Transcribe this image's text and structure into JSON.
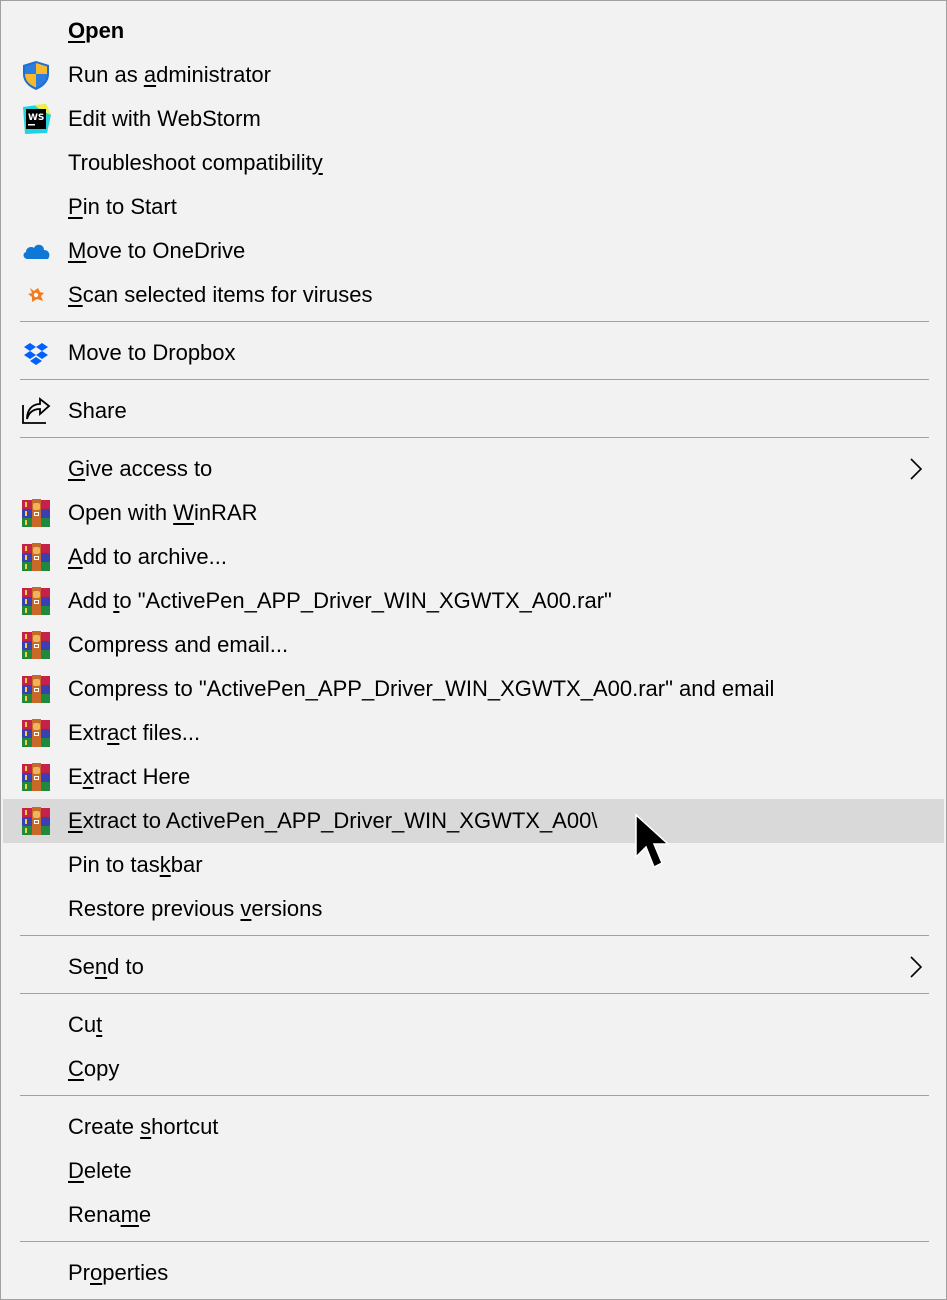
{
  "menu": {
    "highlight_color": "#d9d9d9",
    "items": [
      {
        "id": "open",
        "label": "Open",
        "accel_index": 0,
        "bold": true,
        "icon": null
      },
      {
        "id": "run-as-admin",
        "label": "Run as administrator",
        "accel_index": 7,
        "icon": "uac-shield-icon"
      },
      {
        "id": "edit-webstorm",
        "label": "Edit with WebStorm",
        "accel_index": -1,
        "icon": "webstorm-icon"
      },
      {
        "id": "troubleshoot",
        "label": "Troubleshoot compatibility",
        "accel_index": 25,
        "icon": null
      },
      {
        "id": "pin-start",
        "label": "Pin to Start",
        "accel_index": 0,
        "icon": null
      },
      {
        "id": "move-onedrive",
        "label": "Move to OneDrive",
        "accel_index": 0,
        "icon": "onedrive-icon"
      },
      {
        "id": "scan-viruses",
        "label": "Scan selected items for viruses",
        "accel_index": 0,
        "icon": "avast-icon"
      },
      {
        "id": "move-dropbox",
        "label": "Move to Dropbox",
        "accel_index": -1,
        "icon": "dropbox-icon"
      },
      {
        "id": "share",
        "label": "Share",
        "accel_index": -1,
        "icon": "share-icon"
      },
      {
        "id": "give-access",
        "label": "Give access to",
        "accel_index": 0,
        "icon": null,
        "submenu": true
      },
      {
        "id": "open-winrar",
        "label": "Open with WinRAR",
        "accel_index": 10,
        "icon": "winrar-icon"
      },
      {
        "id": "add-archive",
        "label": "Add to archive...",
        "accel_index": 0,
        "icon": "winrar-icon"
      },
      {
        "id": "add-to-rar",
        "label": "Add to \"ActivePen_APP_Driver_WIN_XGWTX_A00.rar\"",
        "accel_index": 4,
        "icon": "winrar-icon"
      },
      {
        "id": "compress-email",
        "label": "Compress and email...",
        "accel_index": -1,
        "icon": "winrar-icon"
      },
      {
        "id": "compress-to-rar-email",
        "label": "Compress to \"ActivePen_APP_Driver_WIN_XGWTX_A00.rar\" and email",
        "accel_index": -1,
        "icon": "winrar-icon"
      },
      {
        "id": "extract-files",
        "label": "Extract files...",
        "accel_index": 4,
        "icon": "winrar-icon"
      },
      {
        "id": "extract-here",
        "label": "Extract Here",
        "accel_index": 1,
        "icon": "winrar-icon"
      },
      {
        "id": "extract-to-folder",
        "label": "Extract to ActivePen_APP_Driver_WIN_XGWTX_A00\\",
        "accel_index": 0,
        "icon": "winrar-icon",
        "highlighted": true
      },
      {
        "id": "pin-taskbar",
        "label": "Pin to taskbar",
        "accel_index": 10,
        "icon": null
      },
      {
        "id": "restore-versions",
        "label": "Restore previous versions",
        "accel_index": 17,
        "icon": null
      },
      {
        "id": "send-to",
        "label": "Send to",
        "accel_index": 2,
        "icon": null,
        "submenu": true
      },
      {
        "id": "cut",
        "label": "Cut",
        "accel_index": 2,
        "icon": null
      },
      {
        "id": "copy",
        "label": "Copy",
        "accel_index": 0,
        "icon": null
      },
      {
        "id": "create-shortcut",
        "label": "Create shortcut",
        "accel_index": 7,
        "icon": null
      },
      {
        "id": "delete",
        "label": "Delete",
        "accel_index": 0,
        "icon": null
      },
      {
        "id": "rename",
        "label": "Rename",
        "accel_index": 4,
        "icon": null
      },
      {
        "id": "properties",
        "label": "Properties",
        "accel_index": 2,
        "icon": null
      }
    ]
  }
}
